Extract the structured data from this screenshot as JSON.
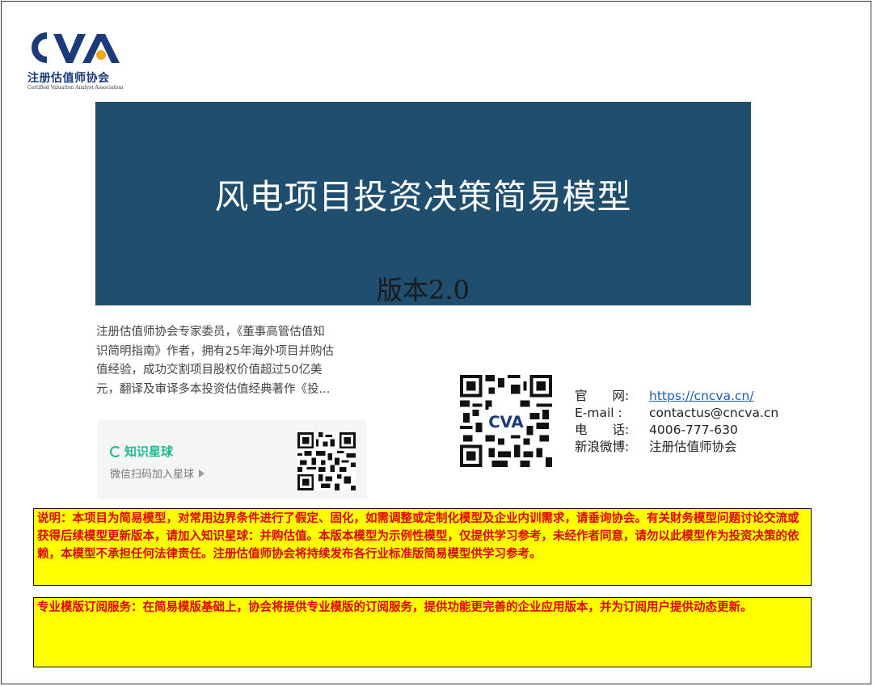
{
  "logo": {
    "mark_text": "CVA",
    "cn_name": "注册估值师协会",
    "en_name": "Certified Valuation Analyst Association"
  },
  "banner": {
    "title": "风电项目投资决策简易模型",
    "version": "版本2.0",
    "background_color": "#1f4e6e"
  },
  "intro": {
    "lines": [
      "注册估值师协会专家委员，《董事高管估值知",
      "识简明指南》作者，拥有25年海外项目并购估",
      "值经验，成功交割项目股权价值超过50亿美",
      "元，翻译及审译多本投资估值经典著作《投..."
    ]
  },
  "planet_card": {
    "brand": "知识星球",
    "subtitle": "微信扫码加入星球",
    "brand_color": "#1fba93"
  },
  "contact": {
    "website_label": "官　　网:",
    "website": "https://cncva.cn/",
    "email_label": "E-mail :",
    "email": "contactus@cncva.cn",
    "phone_label": "电　　话:",
    "phone": "4006-777-630",
    "weibo_label": "新浪微博:",
    "weibo": "注册估值师协会"
  },
  "notes": {
    "note1": "说明：本项目为简易模型，对常用边界条件进行了假定、固化，如需调整或定制化模型及企业内训需求，请垂询协会。有关财务模型问题讨论交流或获得后续模型更新版本，请加入知识星球：并购估值。本版本模型为示例性模型，仅提供学习参考，未经作者同意，请勿以此模型作为投资决策的依赖，本模型不承担任何法律责任。注册估值师协会将持续发布各行业标准版简易模型供学习参考。",
    "note2": "专业模版订阅服务：在简易模版基础上，协会将提供专业模版的订阅服务，提供功能更完善的企业应用版本，并为订阅用户提供动态更新。",
    "background_color": "#ffff00",
    "text_color": "#e00000"
  }
}
